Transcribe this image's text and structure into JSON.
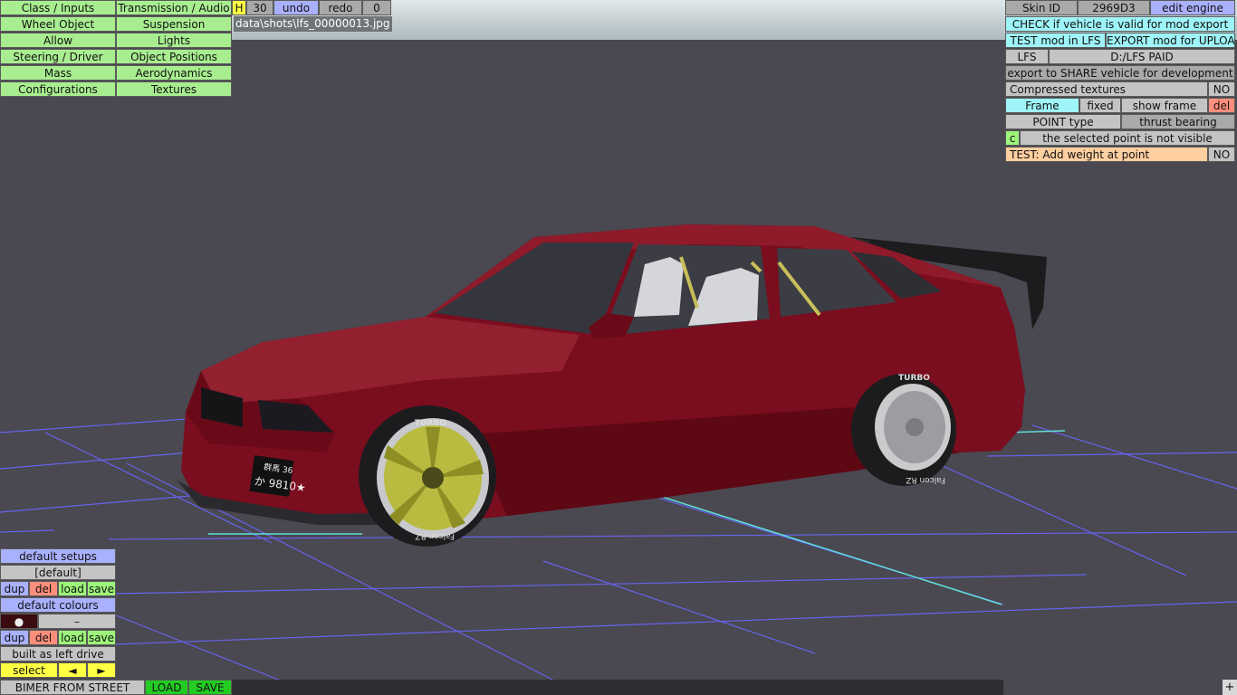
{
  "menu": {
    "col1": [
      "Class / Inputs",
      "Wheel Object",
      "Allow",
      "Steering / Driver",
      "Mass",
      "Configurations"
    ],
    "col2": [
      "Transmission / Audio",
      "Suspension",
      "Lights",
      "Object Positions",
      "Aerodynamics",
      "Textures"
    ]
  },
  "toolbar": {
    "h_label": "H",
    "count": "30",
    "undo": "undo",
    "redo": "redo",
    "redo_count": "0",
    "path": "data\\shots\\lfs_00000013.jpg"
  },
  "right_panel": {
    "skin_id_label": "Skin ID",
    "skin_id_value": "2969D3",
    "edit_engine": "edit engine",
    "check_valid": "CHECK if vehicle is valid for mod export",
    "test_mod": "TEST mod in LFS",
    "export_upload": "EXPORT mod for UPLOAD",
    "lfs_label": "LFS",
    "lfs_path": "D:/LFS PAID",
    "export_share": "export to SHARE vehicle for development",
    "compressed_textures": "Compressed textures",
    "compressed_value": "NO",
    "frame_label": "Frame",
    "frame_fixed": "fixed",
    "show_frame": "show frame",
    "del": "del",
    "point_type_label": "POINT type",
    "point_type_value": "thrust bearing",
    "c_label": "c",
    "point_status": "the selected point is not visible",
    "test_weight": "TEST: Add weight at point",
    "test_weight_value": "NO"
  },
  "left_bottom": {
    "default_setups": "default setups",
    "setup_name": "[default]",
    "dup": "dup",
    "del": "del",
    "load": "load",
    "save": "save",
    "default_colours": "default colours",
    "colour_dot": "●",
    "colour_dash": "–",
    "drive": "built as left drive",
    "select": "select",
    "prev": "◄",
    "next": "►"
  },
  "footer": {
    "vehicle_name": "BIMER FROM STREET",
    "load": "LOAD",
    "save": "SAVE",
    "plus": "+"
  },
  "car": {
    "body_color": "#7a0d1e",
    "plate_top": "群馬 36",
    "plate_bottom": "か 9810★",
    "tire_text": "TURBO",
    "tire_brand": "Falcon RZ"
  }
}
